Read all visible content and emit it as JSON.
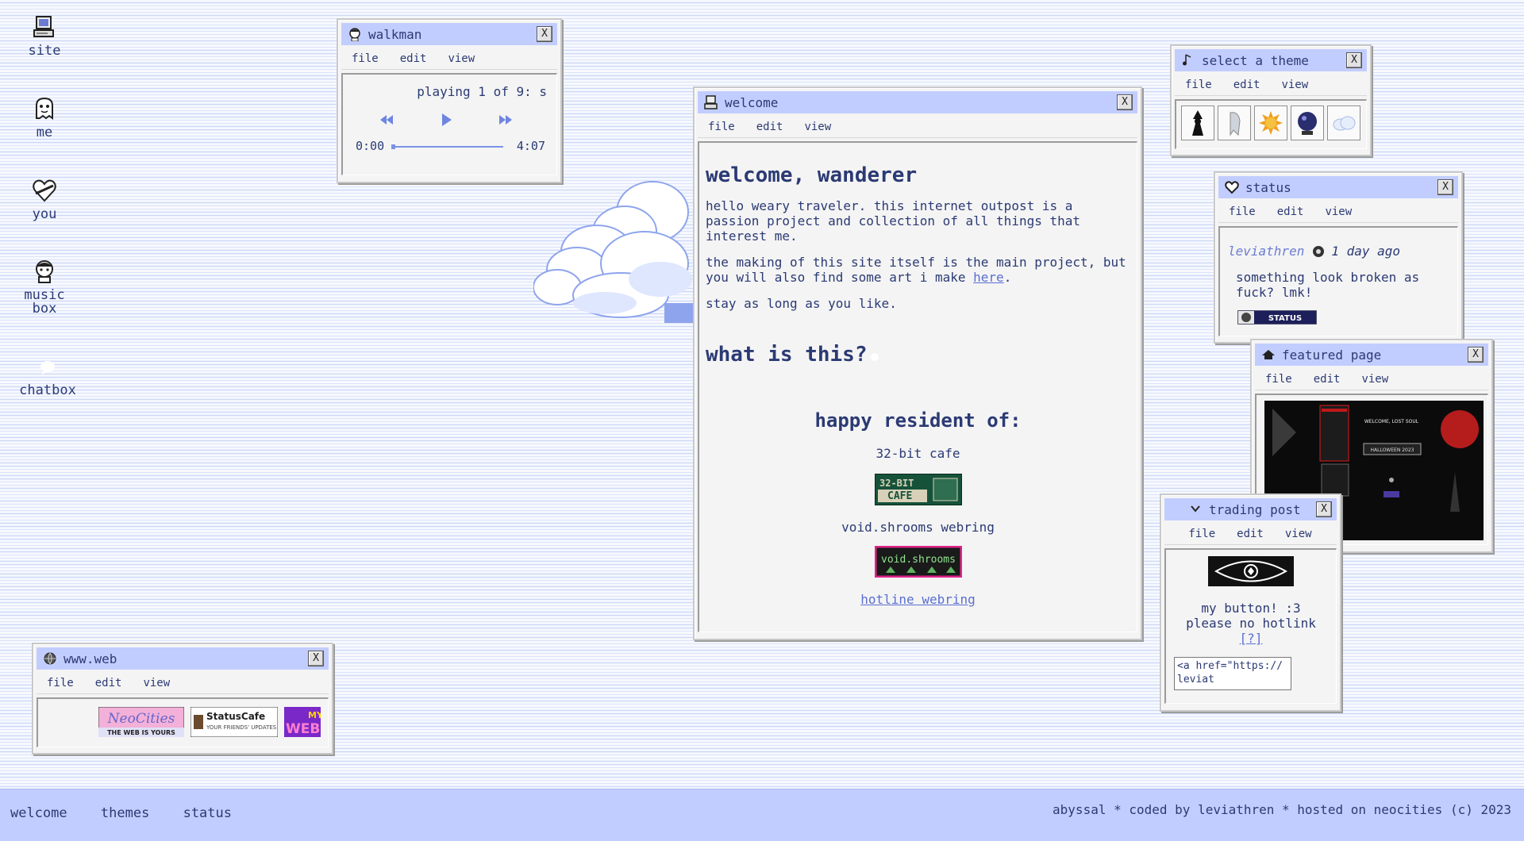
{
  "desktop": {
    "icons": [
      {
        "label": "site"
      },
      {
        "label": "me"
      },
      {
        "label": "you"
      },
      {
        "label": "music\nbox"
      },
      {
        "label": "chatbox"
      }
    ]
  },
  "common_menu": {
    "file": "file",
    "edit": "edit",
    "view": "view"
  },
  "close_label": "X",
  "walkman": {
    "title": "walkman",
    "playing": "playing 1 of 9: s",
    "time_current": "0:00",
    "time_total": "4:07",
    "progress_fraction": 0.0
  },
  "welcome": {
    "title": "welcome",
    "heading": "welcome, wanderer",
    "para1": "hello weary traveler. this internet outpost is a passion project and collection of all things that interest me.",
    "para2_prefix": "the making of this site itself is the main project, but you will also find some art i make ",
    "para2_link": "here",
    "para2_suffix": ".",
    "para3": "stay as long as you like.",
    "heading2": "what is this?",
    "resident_heading": "happy resident of:",
    "resident1": "32-bit cafe",
    "badge1_text_top": "32-BIT",
    "badge1_text_bottom": "CAFE",
    "resident2": "void.shrooms webring",
    "badge2_text": "void.shrooms",
    "resident3_link": "hotline webring"
  },
  "themes": {
    "title": "select a theme",
    "tiles": [
      "witch-theme",
      "ghost-theme",
      "sun-theme",
      "orb-theme",
      "cloud-theme"
    ]
  },
  "status": {
    "title": "status",
    "username": "leviathren",
    "ago": "1 day ago",
    "message": "something look broken as fuck? lmk!",
    "badge_text": "STATUS"
  },
  "featured": {
    "title": "featured page",
    "preview_heading": "WELCOME, LOST SOUL",
    "preview_banner": "HALLOWEEN 2023"
  },
  "trading": {
    "title": "trading post",
    "msg1": "my button! :3",
    "msg2": "please no hotlink",
    "link": "[?]",
    "code": "<a href=\"https://leviat"
  },
  "web": {
    "title": "www.web",
    "b1_top": "NeoCities",
    "b1_bottom": "THE WEB IS YOURS",
    "b2_top": "StatusCafe",
    "b2_bottom": "YOUR FRIENDS' UPDATES",
    "b3_top": "MY",
    "b3_bottom": "WEB"
  },
  "footer": {
    "nav": [
      "welcome",
      "themes",
      "status"
    ],
    "credits": "abyssal * coded by leviathren * hosted on neocities (c) 2023"
  },
  "colors": {
    "accent": "#c2cdff",
    "text": "#2b3a74",
    "link": "#5a6fd0",
    "stripe": "#cdd8f7"
  }
}
